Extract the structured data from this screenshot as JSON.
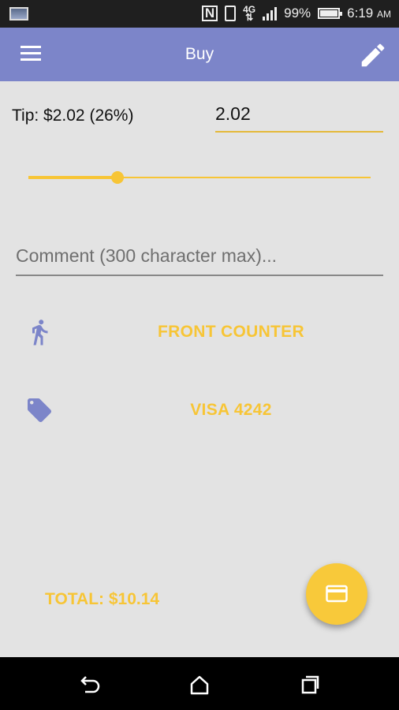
{
  "status_bar": {
    "battery_percent": "99%",
    "time": "6:19",
    "ampm": "AM",
    "network": "4G",
    "icons": [
      "gallery-icon",
      "nfc-icon",
      "vibrate-icon",
      "network-4g-icon",
      "signal-icon",
      "battery-icon"
    ]
  },
  "app_bar": {
    "title": "Buy",
    "icons": [
      "menu-icon",
      "edit-icon"
    ]
  },
  "tip": {
    "label": "Tip: $2.02 (26%)",
    "input_value": "2.02",
    "slider_fraction": 0.26
  },
  "comment": {
    "placeholder": "Comment (300 character max)..."
  },
  "options": [
    {
      "icon": "walking-person-icon",
      "label": "FRONT COUNTER"
    },
    {
      "icon": "tag-icon",
      "label": "VISA 4242"
    }
  ],
  "total": {
    "label": "TOTAL: $10.14"
  },
  "fab": {
    "icon": "credit-card-icon"
  },
  "nav_bar": {
    "icons": [
      "back-icon",
      "home-icon",
      "recents-icon"
    ]
  },
  "colors": {
    "app_bar": "#7c85c9",
    "accent": "#f7c536",
    "background": "#e3e3e3",
    "icon_tint": "#7c85c9"
  }
}
